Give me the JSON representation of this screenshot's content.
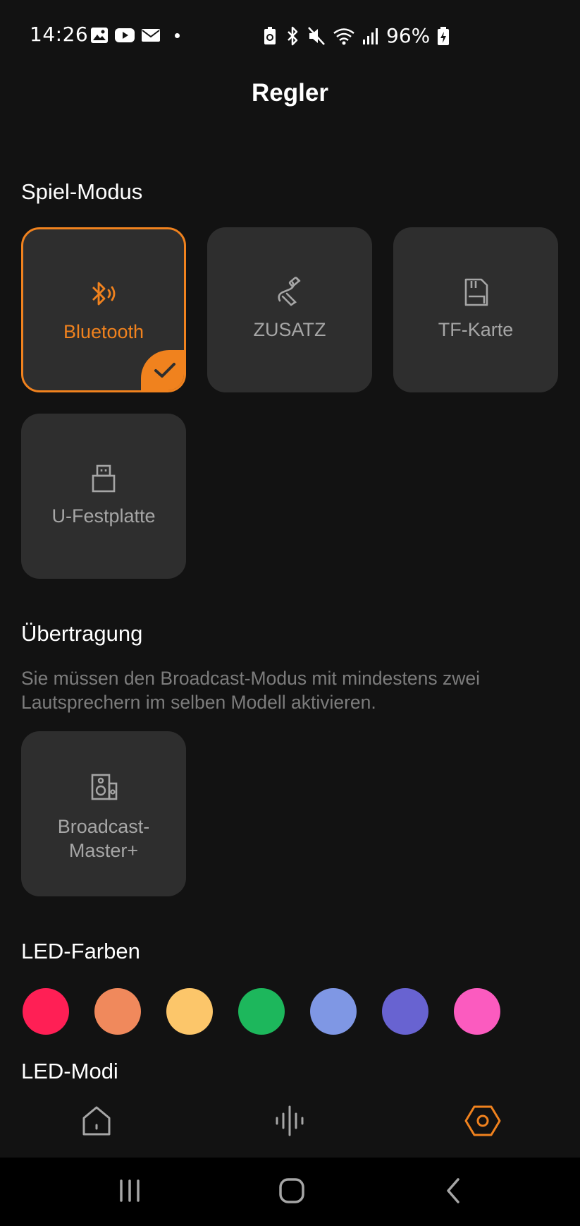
{
  "status_bar": {
    "time": "14:26",
    "battery_percent": "96%",
    "left_icons": [
      "gallery-icon",
      "youtube-icon",
      "mail-icon",
      "dot-icon"
    ],
    "right_icons": [
      "battery-saver-icon",
      "bluetooth-icon",
      "mute-icon",
      "wifi-icon",
      "signal-icon",
      "battery-charging-icon"
    ]
  },
  "header": {
    "title": "Regler"
  },
  "play_mode": {
    "title": "Spiel-Modus",
    "items": [
      {
        "label": "Bluetooth",
        "icon": "bluetooth-audio-icon",
        "selected": true
      },
      {
        "label": "ZUSATZ",
        "icon": "aux-cable-icon",
        "selected": false
      },
      {
        "label": "TF-Karte",
        "icon": "sd-card-icon",
        "selected": false
      },
      {
        "label": "U-Festplatte",
        "icon": "usb-drive-icon",
        "selected": false
      }
    ]
  },
  "broadcast": {
    "title": "Übertragung",
    "description": "Sie müssen den Broadcast-Modus mit mindestens zwei Lautsprechern im selben Modell aktivieren.",
    "item": {
      "label_line1": "Broadcast-",
      "label_line2": "Master+",
      "icon": "speaker-icon"
    }
  },
  "led_colors": {
    "title": "LED-Farben",
    "colors": [
      "#ff1f55",
      "#f0895c",
      "#fcc66a",
      "#1db75c",
      "#7f97e4",
      "#6863d1",
      "#fb5bbf"
    ]
  },
  "led_modes": {
    "title": "LED-Modi"
  },
  "bottom_nav": {
    "items": [
      {
        "name": "home",
        "icon": "home-icon",
        "active": false
      },
      {
        "name": "equalizer",
        "icon": "sound-wave-icon",
        "active": false
      },
      {
        "name": "settings",
        "icon": "hexagon-settings-icon",
        "active": true
      }
    ]
  },
  "theme": {
    "accent": "#f0821e",
    "background": "#121212",
    "tile": "#2e2e2e",
    "muted_text": "#a6a6a6"
  }
}
